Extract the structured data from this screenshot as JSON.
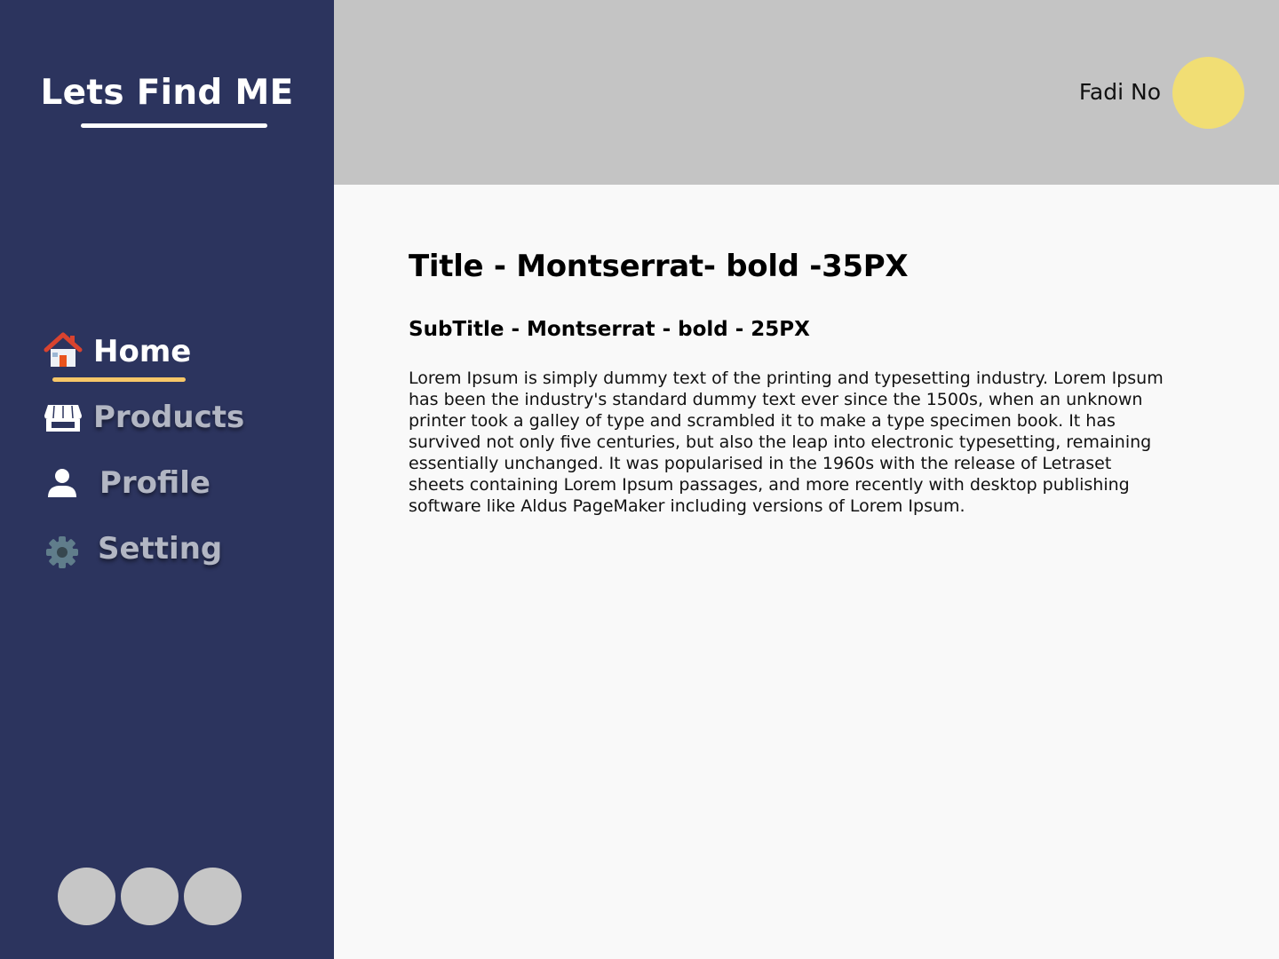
{
  "sidebar": {
    "brand": "Lets Find ME",
    "nav": [
      {
        "label": "Home",
        "icon": "home-icon",
        "active": true
      },
      {
        "label": "Products",
        "icon": "store-icon",
        "active": false
      },
      {
        "label": "Profile",
        "icon": "user-icon",
        "active": false
      },
      {
        "label": "Setting",
        "icon": "gear-icon",
        "active": false
      }
    ],
    "bottom_buttons": [
      "circle-button",
      "circle-button",
      "circle-button"
    ]
  },
  "header": {
    "user_name": "Fadi No"
  },
  "main": {
    "title": "Title - Montserrat- bold -35PX",
    "subtitle": "SubTitle - Montserrat - bold - 25PX",
    "body": "Lorem Ipsum is simply dummy text of the printing and typesetting industry. Lorem Ipsum has been the industry's standard dummy text ever since the 1500s, when an unknown printer took a galley of type and scrambled it to make a type specimen book. It has survived not only five centuries, but also the leap into electronic typesetting, remaining essentially unchanged. It was popularised in the 1960s with the release of Letraset sheets containing Lorem Ipsum passages, and more recently with desktop publishing software like Aldus PageMaker including versions of Lorem Ipsum."
  },
  "colors": {
    "sidebar_bg": "#2c345e",
    "topbar_bg": "#c4c4c4",
    "content_bg": "#f9f9f9",
    "active_accent": "#f7c768",
    "avatar": "#f1de74",
    "inactive_label": "#b2b6c3"
  }
}
